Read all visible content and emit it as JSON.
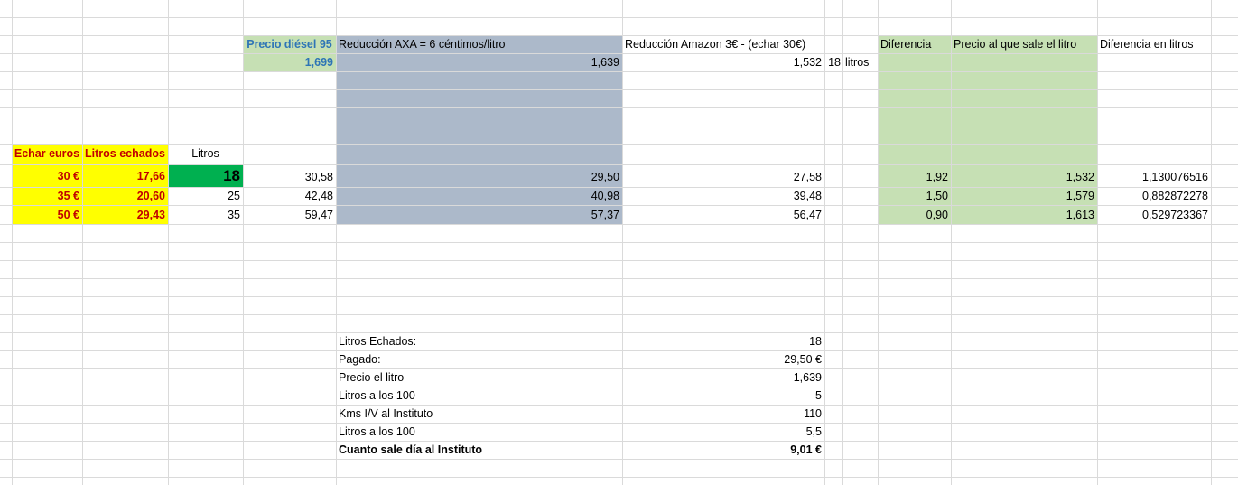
{
  "colors": {
    "green_light": "#c6e0b4",
    "gray_blue": "#acb9ca",
    "yellow": "#ffff00",
    "green_dark": "#00b050",
    "red_text": "#c00000",
    "blue_text": "#2e75b6",
    "gridline": "#dadada"
  },
  "header": {
    "precio_label": "Precio diésel 95",
    "axa_label": "Reducción AXA  = 6 céntimos/litro",
    "amazon_label": "Reducción Amazon 3€ - (echar 30€)",
    "diferencia_label": "Diferencia",
    "precio_litro_label": "Precio al que sale el litro",
    "diferencia_litros_label": "Diferencia en litros"
  },
  "prices": {
    "precio": "1,699",
    "axa": "1,639",
    "amazon": "1,532",
    "amazon_litros_num": "18",
    "amazon_litros_unit": "litros"
  },
  "table": {
    "echar_header": "Echar euros",
    "litros_echados_header": "Litros echados",
    "litros_header": "Litros",
    "rows": [
      {
        "echar": "30 €",
        "litros_echados": "17,66",
        "litros": "18",
        "precio": "30,58",
        "axa": "29,50",
        "amazon": "27,58",
        "diferencia": "1,92",
        "precio_litro": "1,532",
        "diferencia_litros": "1,130076516"
      },
      {
        "echar": "35 €",
        "litros_echados": "20,60",
        "litros": "25",
        "precio": "42,48",
        "axa": "40,98",
        "amazon": "39,48",
        "diferencia": "1,50",
        "precio_litro": "1,579",
        "diferencia_litros": "0,882872278"
      },
      {
        "echar": "50 €",
        "litros_echados": "29,43",
        "litros": "35",
        "precio": "59,47",
        "axa": "57,37",
        "amazon": "56,47",
        "diferencia": "0,90",
        "precio_litro": "1,613",
        "diferencia_litros": "0,529723367"
      }
    ]
  },
  "summary": [
    {
      "label": "Litros Echados:",
      "value": "18"
    },
    {
      "label": "Pagado:",
      "value": "29,50 €"
    },
    {
      "label": "Precio el litro",
      "value": "1,639"
    },
    {
      "label": "Litros a los 100",
      "value": "5"
    },
    {
      "label": "Kms I/V al Instituto",
      "value": "110"
    },
    {
      "label": "Litros a los 100",
      "value": "5,5"
    },
    {
      "label": "Cuanto sale día al Instituto",
      "value": "9,01 €",
      "bold": true
    }
  ]
}
